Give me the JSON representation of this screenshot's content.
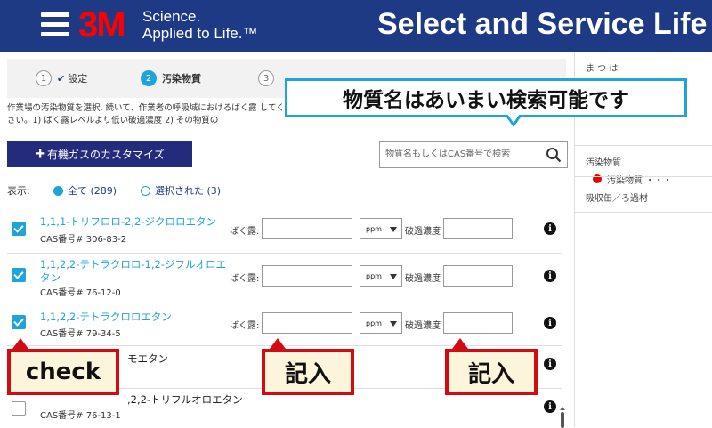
{
  "header": {
    "brand": "3M",
    "tagline_line1": "Science.",
    "tagline_line2": "Applied to Life.™",
    "app_title": "Select and Service Life"
  },
  "stepper": {
    "steps": [
      {
        "number": "1",
        "label": "設定",
        "state": "done"
      },
      {
        "number": "2",
        "label": "汚染物質",
        "state": "active"
      },
      {
        "number": "3",
        "label": "",
        "state": "pending"
      }
    ]
  },
  "description": "作業場の汚染物質を選択, 続いて、作業者の呼吸域におけるばく露 してください。1) ばく露レベルより低い破過濃度 2) その物質の",
  "customize_button": "有機ガスのカスタマイズ",
  "search": {
    "placeholder": "物質名もしくはCAS番号で検索"
  },
  "filter": {
    "label": "表示:",
    "options": [
      {
        "label": "全て (289)",
        "selected": true
      },
      {
        "label": "選択された (3)",
        "selected": false
      }
    ]
  },
  "field_labels": {
    "exposure": "ばく露:",
    "breakthrough": "破過濃度",
    "unit": "ppm"
  },
  "substances": [
    {
      "name": "1,1,1-トリフロロ-2,2-ジクロロエタン",
      "cas": "CAS番号# 306-83-2",
      "checked": true,
      "exposure": "",
      "unit": "ppm",
      "breakthrough": ""
    },
    {
      "name": "1,1,2,2-テトラクロロ-1,2-ジフルオロエタン",
      "cas": "CAS番号# 76-12-0",
      "checked": true,
      "exposure": "",
      "unit": "ppm",
      "breakthrough": ""
    },
    {
      "name": "1,1,2,2-テトラクロロエタン",
      "cas": "CAS番号# 79-34-5",
      "checked": true,
      "exposure": "",
      "unit": "ppm",
      "breakthrough": ""
    },
    {
      "name": "モエタン",
      "cas": "",
      "checked": false
    },
    {
      "name": ",2,2-トリフルオロエタン",
      "cas": "CAS番号# 76-13-1",
      "checked": false
    }
  ],
  "right_panel": {
    "top_label": "ま つ は",
    "selected_text": "汚染物質 ・・・",
    "items": [
      "汚染物質",
      "吸収缶／ろ過材"
    ]
  },
  "annotations": {
    "search_hint": "物質名はあいまい検索可能です",
    "check": "check",
    "enter_exposure": "記入",
    "enter_breakthrough": "記入"
  },
  "colors": {
    "header_bg": "#1f3a85",
    "brand_red": "#ff0000",
    "accent": "#1ea4d8",
    "button_bg": "#232b7a",
    "callout_border": "#d20a11",
    "callout_bg": "#fdf4dc"
  }
}
